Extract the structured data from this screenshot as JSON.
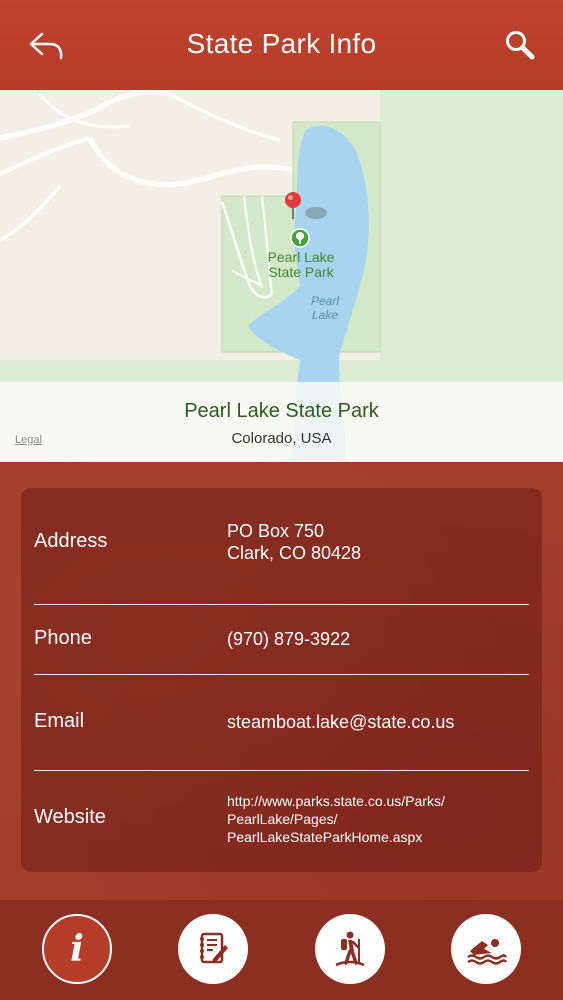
{
  "header": {
    "title": "State Park Info",
    "back_icon": "back-arrow-icon",
    "search_icon": "search-icon"
  },
  "map": {
    "labels": {
      "park": "Pearl Lake\nState Park",
      "lake": "Pearl\nLake"
    },
    "place_name": "Pearl Lake State Park",
    "region": "Colorado, USA",
    "legal": "Legal",
    "pin_icon": "map-pin-icon",
    "park_icon": "park-tree-icon"
  },
  "details": {
    "address": {
      "label": "Address",
      "line1": "PO Box 750",
      "line2": "Clark, CO 80428"
    },
    "phone": {
      "label": "Phone",
      "value": "(970) 879-3922"
    },
    "email": {
      "label": "Email",
      "value": "steamboat.lake@state.co.us"
    },
    "website": {
      "label": "Website",
      "line1": "http://www.parks.state.co.us/Parks/",
      "line2": "PearlLake/Pages/",
      "line3": "PearlLakeStateParkHome.aspx"
    }
  },
  "tabs": [
    {
      "name": "info",
      "icon": "info-icon",
      "active": true
    },
    {
      "name": "notes",
      "icon": "notes-icon",
      "active": false
    },
    {
      "name": "hiking",
      "icon": "hiker-icon",
      "active": false
    },
    {
      "name": "swimming",
      "icon": "swimmer-icon",
      "active": false
    }
  ],
  "colors": {
    "header": "#b53c28",
    "content": "#a23d2c",
    "tabbar": "#8c2f22",
    "park_green": "#d2e8c8",
    "water": "#a8d4ef"
  }
}
